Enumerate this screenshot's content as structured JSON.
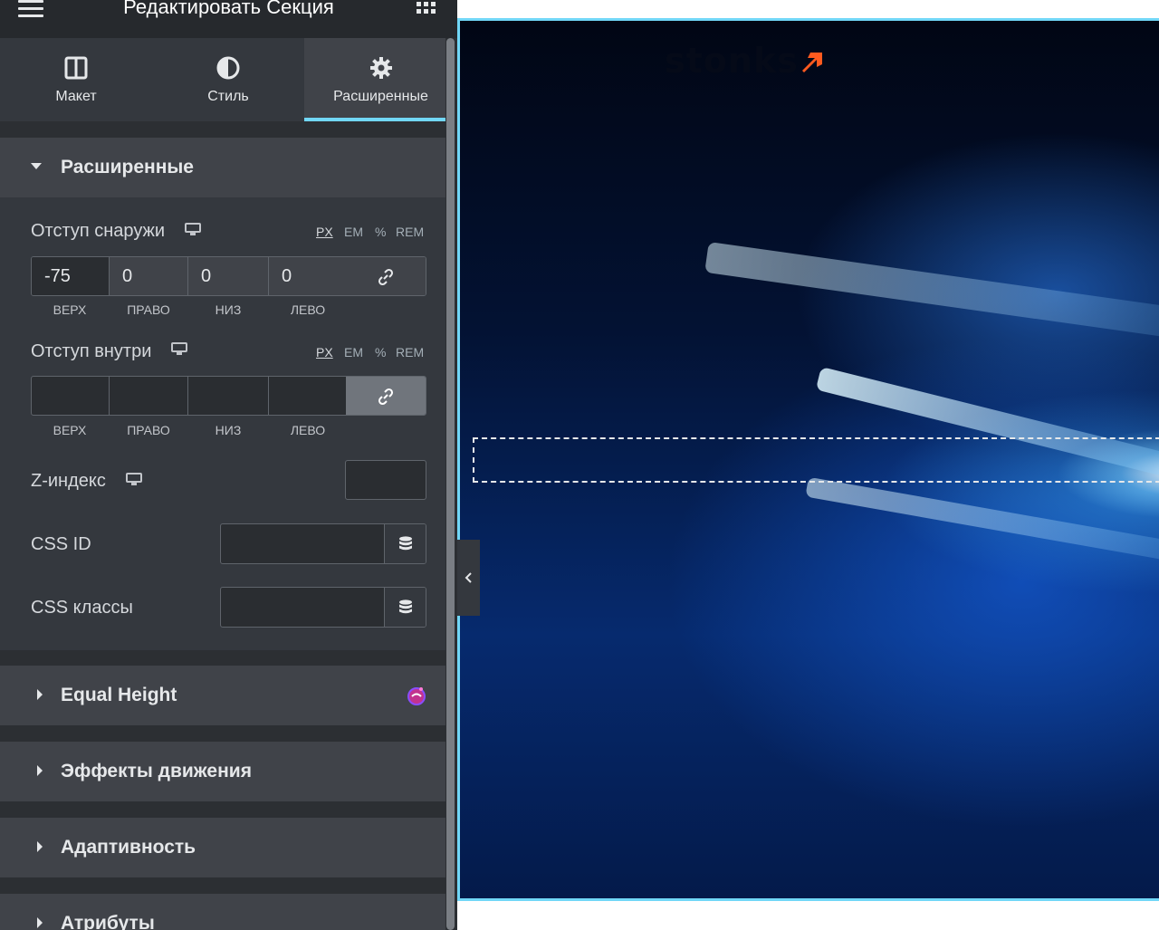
{
  "header": {
    "title": "Редактировать Секция"
  },
  "tabs": [
    {
      "label": "Макет",
      "icon": "columns-icon"
    },
    {
      "label": "Стиль",
      "icon": "half-circle-icon"
    },
    {
      "label": "Расширенные",
      "icon": "gear-icon",
      "active": true
    }
  ],
  "advanced": {
    "title": "Расширенные",
    "margin": {
      "label": "Отступ снаружи",
      "units": [
        "PX",
        "EM",
        "%",
        "REM"
      ],
      "active_unit": "PX",
      "top": "-75",
      "right": "0",
      "bottom": "0",
      "left": "0",
      "side_labels": [
        "ВЕРХ",
        "ПРАВО",
        "НИЗ",
        "ЛЕВО"
      ],
      "linked": false
    },
    "padding": {
      "label": "Отступ внутри",
      "units": [
        "PX",
        "EM",
        "%",
        "REM"
      ],
      "active_unit": "PX",
      "top": "",
      "right": "",
      "bottom": "",
      "left": "",
      "side_labels": [
        "ВЕРХ",
        "ПРАВО",
        "НИЗ",
        "ЛЕВО"
      ],
      "linked": true
    },
    "z_index": {
      "label": "Z-индекс",
      "value": ""
    },
    "css_id": {
      "label": "CSS ID",
      "value": ""
    },
    "css_classes": {
      "label": "CSS классы",
      "value": ""
    }
  },
  "sections": [
    {
      "title": "Equal Height",
      "badge_icon": "pro-badge-icon"
    },
    {
      "title": "Эффекты движения"
    },
    {
      "title": "Адаптивность"
    },
    {
      "title": "Атрибуты"
    }
  ],
  "preview": {
    "logo_text": "stonks",
    "accent_color": "#ff5a1f",
    "selection_color": "#71d7f7"
  }
}
